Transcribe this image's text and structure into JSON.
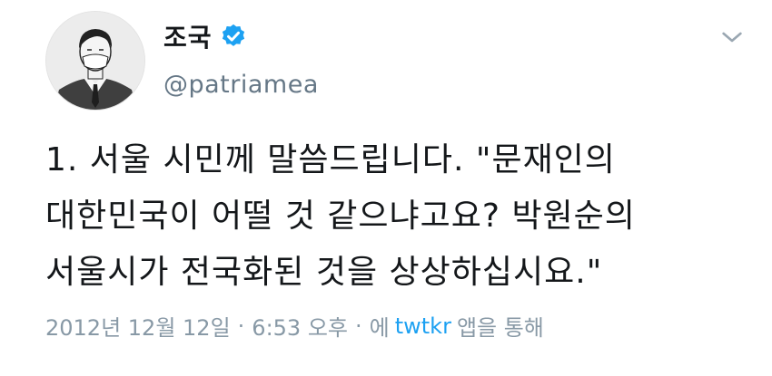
{
  "tweet": {
    "author": {
      "display_name": "조국",
      "handle": "@patriamea",
      "verified": true,
      "avatar_icon": "caricature-avatar-icon"
    },
    "text_lines": [
      "1. 서울 시민께 말씀드립니다. \"문재인의",
      "대한민국이 어떨 것 같으냐고요? 박원순의",
      "서울시가 전국화된 것을 상상하십시요.\""
    ],
    "meta": {
      "date": "2012년 12월 12일",
      "dot1": "·",
      "time": "6:53 오후",
      "dot2": "·",
      "via_prefix": "에",
      "source": "twtkr",
      "via_suffix": "앱을 통해"
    }
  },
  "colors": {
    "verified": "#1da1f2",
    "link": "#1da1f2",
    "secondary_text": "#8899a6",
    "handle": "#657786"
  }
}
